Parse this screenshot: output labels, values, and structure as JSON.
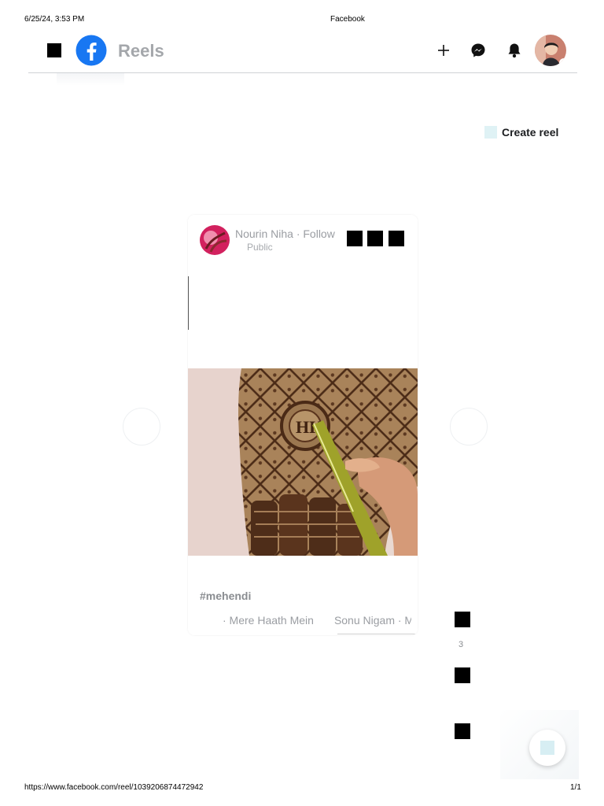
{
  "print": {
    "date": "6/25/24, 3:53 PM",
    "title": "Facebook",
    "url": "https://www.facebook.com/reel/1039206874472942",
    "page": "1/1"
  },
  "header": {
    "section_title": "Reels",
    "brand_color": "#1877f2",
    "icons": [
      "menu-icon",
      "facebook-logo-icon",
      "plus-icon",
      "messenger-icon",
      "bell-icon",
      "avatar"
    ]
  },
  "create_reel": {
    "label": "Create reel"
  },
  "reel": {
    "author_line": "Nourin Niha · Follow",
    "privacy": "Public",
    "hashtag": "#mehendi",
    "music": {
      "song": "· Mere Haath Mein",
      "artist": "Sonu Nigam · M"
    }
  },
  "actions": {
    "like_count": "3"
  }
}
